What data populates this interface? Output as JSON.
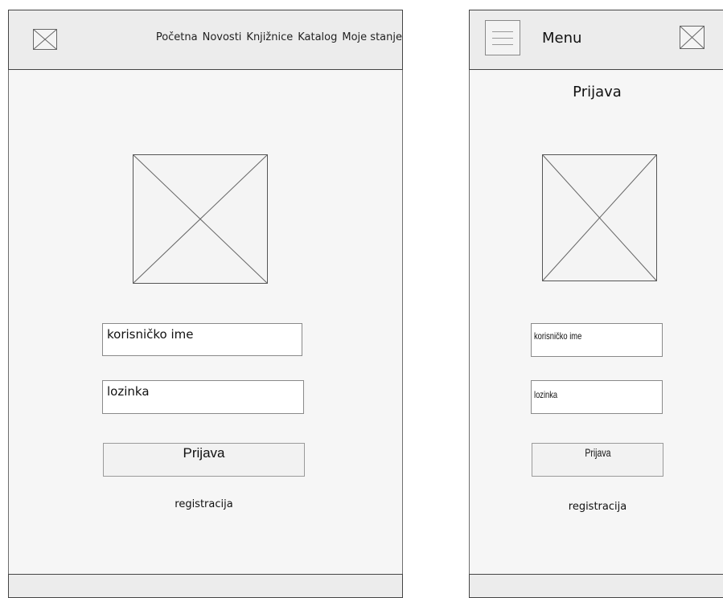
{
  "desktop": {
    "nav": [
      "Početna",
      "Novosti",
      "Knjižnice",
      "Katalog",
      "Moje stanje"
    ],
    "username_placeholder": "korisničko ime",
    "password_placeholder": "lozinka",
    "login_button": "Prijava",
    "register_link": "registracija"
  },
  "mobile": {
    "menu_label": "Menu",
    "page_title": "Prijava",
    "username_placeholder": "korisničko ime",
    "password_placeholder": "lozinka",
    "login_button": "Prijava",
    "register_link": "registracija"
  },
  "icons": {
    "image_placeholder": "image-placeholder-icon",
    "hamburger": "hamburger-menu-icon"
  }
}
